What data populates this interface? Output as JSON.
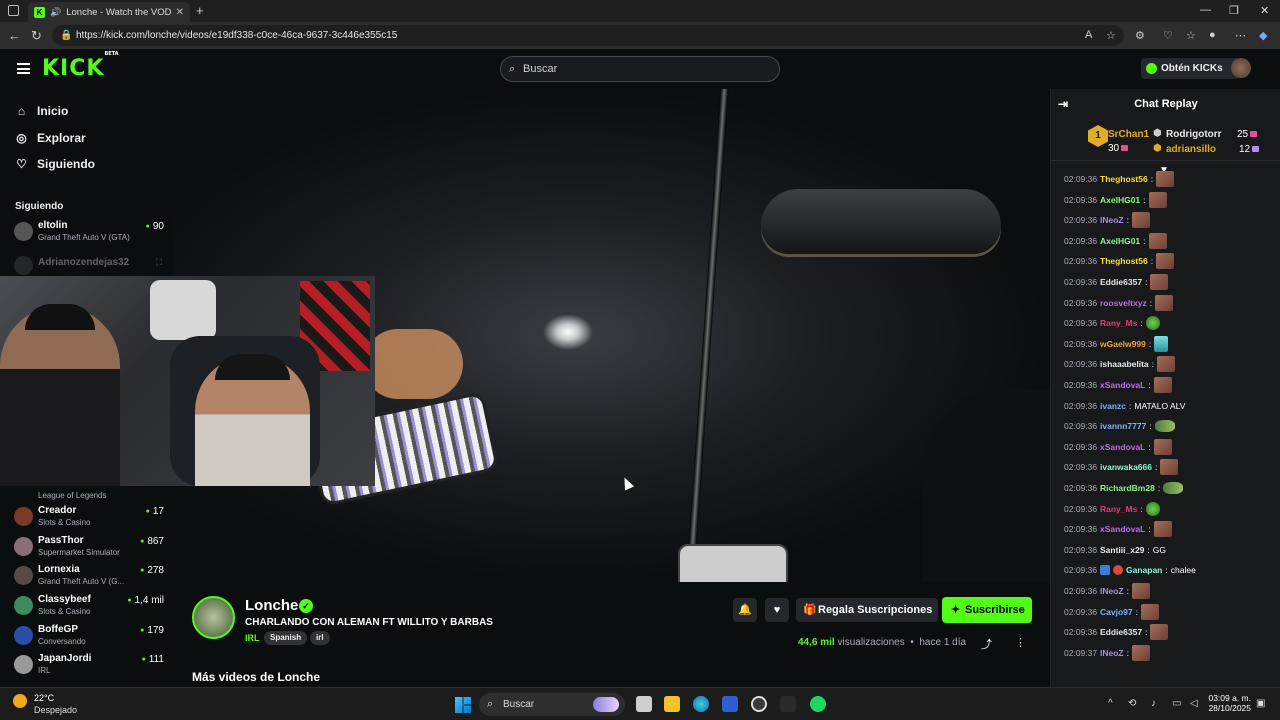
{
  "browser": {
    "tab_title": "Lonche - Watch the VOD on",
    "url": "https://kick.com/lonche/videos/e19df338-c0ce-46ca-9637-3c446e355c15"
  },
  "header": {
    "logo": "KICK",
    "logo_beta": "BETA",
    "search_placeholder": "Buscar",
    "get_kicks": "Obtén KICKs"
  },
  "sidebar": {
    "nav": [
      {
        "label": "Inicio",
        "icon": "home-icon"
      },
      {
        "label": "Explorar",
        "icon": "compass-icon"
      },
      {
        "label": "Siguiendo",
        "icon": "heart-icon"
      }
    ],
    "following_heading": "Siguiendo",
    "following": [
      {
        "name": "eltolin",
        "game": "Grand Theft Auto V (GTA)",
        "viewers": "90"
      },
      {
        "name": "Adrianozendejas32",
        "game": "",
        "viewers": ""
      },
      {
        "name": "",
        "game": "League of Legends",
        "viewers": ""
      },
      {
        "name": "Creador",
        "game": "Slots & Casino",
        "viewers": "17"
      },
      {
        "name": "PassThor",
        "game": "Supermarket Simulator",
        "viewers": "867"
      },
      {
        "name": "Lornexia",
        "game": "Grand Theft Auto V (G...",
        "viewers": "278"
      },
      {
        "name": "Classybeef",
        "game": "Slots & Casino",
        "viewers": "1,4 mil"
      },
      {
        "name": "BoffeGP",
        "game": "Conversando",
        "viewers": "179"
      },
      {
        "name": "JapanJordi",
        "game": "IRL",
        "viewers": "111"
      }
    ]
  },
  "stream": {
    "channel": "Lonche",
    "title": "CHARLANDO CON ALEMAN FT WILLITO Y BARBAS",
    "category": "IRL",
    "tags": [
      "Spanish",
      "irl"
    ],
    "gift_subs": "Regala Suscripciones",
    "subscribe": "Suscribirse",
    "views": "44,6 mil",
    "views_label": "visualizaciones",
    "ago": "hace 1 día",
    "more_videos": "Más videos de Lonche"
  },
  "chat": {
    "title": "Chat Replay",
    "leaderboard": [
      {
        "name": "SrChan1",
        "count": "30",
        "color": "#e0ac2a"
      },
      {
        "name": "Rodrigotorr",
        "count": "25",
        "color": "#e8e8e8"
      },
      {
        "name": "adriansillo",
        "count": "12",
        "color": "#e0ac2a"
      }
    ],
    "messages": [
      {
        "time": "02:09:36",
        "user": "Theghost56",
        "color": "#f6dd3f",
        "text": "",
        "emote": "e"
      },
      {
        "time": "02:09:36",
        "user": "AxelHG01",
        "color": "#8ef58a",
        "text": "",
        "emote": "e"
      },
      {
        "time": "02:09:36",
        "user": "lNeoZ",
        "color": "#a98ef0",
        "text": "",
        "emote": "e"
      },
      {
        "time": "02:09:36",
        "user": "AxelHG01",
        "color": "#8ef58a",
        "text": "",
        "emote": "e"
      },
      {
        "time": "02:09:36",
        "user": "Theghost56",
        "color": "#f6dd3f",
        "text": "",
        "emote": "e"
      },
      {
        "time": "02:09:36",
        "user": "Eddie6357",
        "color": "#e8e8e8",
        "text": "",
        "emote": "e"
      },
      {
        "time": "02:09:36",
        "user": "roosveltxyz",
        "color": "#c06be6",
        "text": "",
        "emote": "e"
      },
      {
        "time": "02:09:36",
        "user": "Rany_Ms",
        "color": "#e8397a",
        "text": "",
        "emote": "g"
      },
      {
        "time": "02:09:36",
        "user": "wGaelw999",
        "color": "#f2a23a",
        "text": "",
        "emote": "c"
      },
      {
        "time": "02:09:36",
        "user": "ishaaabelita",
        "color": "#e8e8e8",
        "text": "",
        "emote": "e"
      },
      {
        "time": "02:09:36",
        "user": "xSandovaL",
        "color": "#c06be6",
        "text": "",
        "emote": "e"
      },
      {
        "time": "02:09:36",
        "user": "ivanzc",
        "color": "#7db3ff",
        "text": "MATALO ALV",
        "emote": ""
      },
      {
        "time": "02:09:36",
        "user": "ivannn7777",
        "color": "#7db3ff",
        "text": "",
        "emote": "f"
      },
      {
        "time": "02:09:36",
        "user": "xSandovaL",
        "color": "#c06be6",
        "text": "",
        "emote": "e"
      },
      {
        "time": "02:09:36",
        "user": "ivanwaka666",
        "color": "#8ef5d8",
        "text": "",
        "emote": "e"
      },
      {
        "time": "02:09:36",
        "user": "RichardBm28",
        "color": "#8ef58a",
        "text": "",
        "emote": "f"
      },
      {
        "time": "02:09:36",
        "user": "Rany_Ms",
        "color": "#e8397a",
        "text": "",
        "emote": "g"
      },
      {
        "time": "02:09:36",
        "user": "xSandovaL",
        "color": "#c06be6",
        "text": "",
        "emote": "e"
      },
      {
        "time": "02:09:36",
        "user": "Santiii_x29",
        "color": "#e8e8e8",
        "text": "GG",
        "emote": ""
      },
      {
        "time": "02:09:36",
        "user": "Ganapan",
        "color": "#8ef5d8",
        "text": "chalee",
        "emote": "",
        "badges": true
      },
      {
        "time": "02:09:36",
        "user": "lNeoZ",
        "color": "#a98ef0",
        "text": "",
        "emote": "e"
      },
      {
        "time": "02:09:36",
        "user": "Cavjo97",
        "color": "#7db3ff",
        "text": "",
        "emote": "e"
      },
      {
        "time": "02:09:36",
        "user": "Eddie6357",
        "color": "#e8e8e8",
        "text": "",
        "emote": "e"
      },
      {
        "time": "02:09:37",
        "user": "lNeoZ",
        "color": "#a98ef0",
        "text": "",
        "emote": "e"
      }
    ]
  },
  "taskbar": {
    "temp": "22°C",
    "condition": "Despejado",
    "search": "Buscar",
    "time": "03:09 a. m.",
    "date": "28/10/2025"
  }
}
